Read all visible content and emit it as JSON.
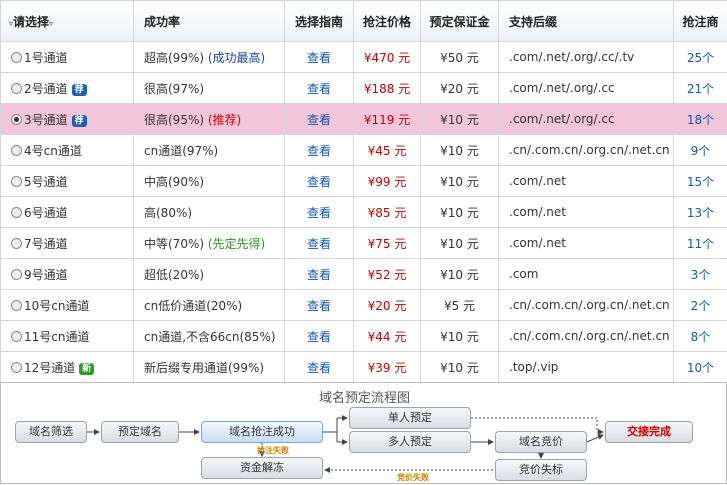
{
  "header": {
    "col1": "请选择",
    "col2": "成功率",
    "col3": "选择指南",
    "col4": "抢注价格",
    "col5": "预定保证金",
    "col6": "支持后缀",
    "col7": "抢注商"
  },
  "rows": [
    {
      "name": "1号通道",
      "badge": "",
      "rate": "超高(99%)",
      "note": "(成功最高)",
      "note_color": "blue",
      "guide": "查看",
      "price": "¥470 元",
      "deposit": "¥50 元",
      "suffix": ".com/.net/.org/.cc/.tv",
      "count": "25个"
    },
    {
      "name": "2号通道",
      "badge": "荐",
      "rate": "很高(97%)",
      "note": "",
      "note_color": "",
      "guide": "查看",
      "price": "¥188 元",
      "deposit": "¥20 元",
      "suffix": ".com/.net/.org/.cc",
      "count": "21个"
    },
    {
      "name": "3号通道",
      "badge": "荐",
      "rate": "很高(95%)",
      "note": "(推荐)",
      "note_color": "red",
      "guide": "查看",
      "price": "¥119 元",
      "deposit": "¥10 元",
      "suffix": ".com/.net/.org/.cc",
      "count": "18个"
    },
    {
      "name": "4号cn通道",
      "badge": "",
      "rate": "cn通道(97%)",
      "note": "",
      "note_color": "",
      "guide": "查看",
      "price": "¥45 元",
      "deposit": "¥10 元",
      "suffix": ".cn/.com.cn/.org.cn/.net.cn",
      "count": "9个"
    },
    {
      "name": "5号通道",
      "badge": "",
      "rate": "中高(90%)",
      "note": "",
      "note_color": "",
      "guide": "查看",
      "price": "¥99 元",
      "deposit": "¥10 元",
      "suffix": ".com/.net",
      "count": "15个"
    },
    {
      "name": "6号通道",
      "badge": "",
      "rate": "高(80%)",
      "note": "",
      "note_color": "",
      "guide": "查看",
      "price": "¥85 元",
      "deposit": "¥10 元",
      "suffix": ".com/.net",
      "count": "13个"
    },
    {
      "name": "7号通道",
      "badge": "",
      "rate": "中等(70%)",
      "note": "(先定先得)",
      "note_color": "green",
      "guide": "查看",
      "price": "¥75 元",
      "deposit": "¥10 元",
      "suffix": ".com/.net",
      "count": "11个"
    },
    {
      "name": "9号通道",
      "badge": "",
      "rate": "超低(20%)",
      "note": "",
      "note_color": "",
      "guide": "查看",
      "price": "¥52 元",
      "deposit": "¥10 元",
      "suffix": ".com",
      "count": "3个"
    },
    {
      "name": "10号cn通道",
      "badge": "",
      "rate": "cn低价通道(20%)",
      "note": "",
      "note_color": "",
      "guide": "查看",
      "price": "¥20 元",
      "deposit": "¥5 元",
      "suffix": ".cn/.com.cn/.org.cn/.net.cn",
      "count": "2个"
    },
    {
      "name": "11号cn通道",
      "badge": "",
      "rate": "cn通道,不含66cn(85%)",
      "note": "",
      "note_color": "",
      "guide": "查看",
      "price": "¥44 元",
      "deposit": "¥10 元",
      "suffix": ".cn/.com.cn/.org.cn/.net.cn",
      "count": "8个"
    },
    {
      "name": "12号通道",
      "badge": "新",
      "rate": "新后缀专用通道(99%)",
      "note": "",
      "note_color": "",
      "guide": "查看",
      "price": "¥39 元",
      "deposit": "¥10 元",
      "suffix": ".top/.vip",
      "count": "10个"
    }
  ],
  "selected_row": 2,
  "flow": {
    "title": "域名预定流程图",
    "screen": "域名筛选",
    "reserve": "预定域名",
    "grab_success": "域名抢注成功",
    "single": "单人预定",
    "multi": "多人预定",
    "auction": "域名竞价",
    "done": "交接完成",
    "unfreeze": "资金解冻",
    "auction_fail": "竞价失标",
    "grab_fail_tag": "抢注失败",
    "auction_fail_tag": "竞价失败"
  }
}
